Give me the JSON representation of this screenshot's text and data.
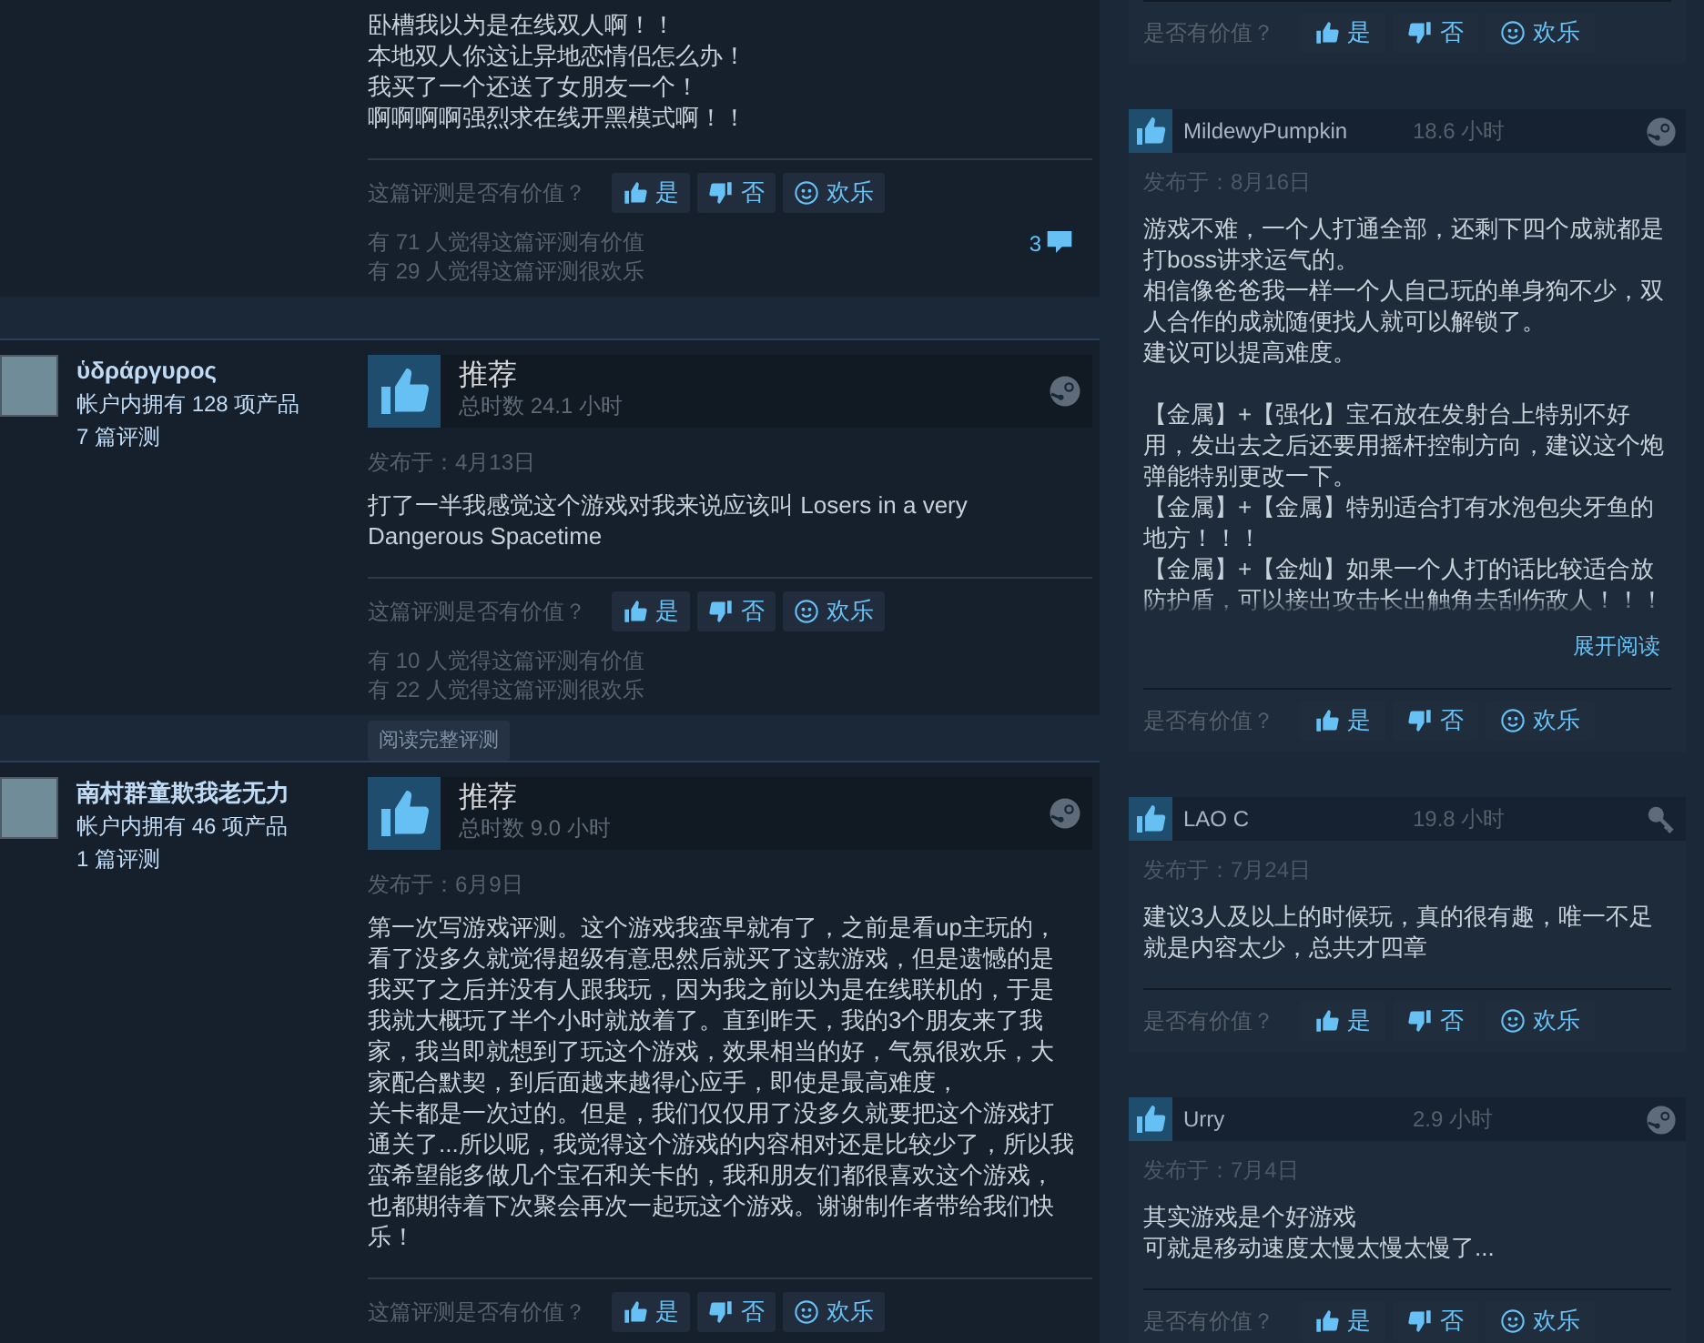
{
  "main_reviews": [
    {
      "blocks": [
        [
          "卧槽我以为是在线双人啊！！",
          "本地双人你这让异地恋情侣怎么办！",
          "我买了一个还送了女朋友一个！",
          "啊啊啊啊强烈求在线开黑模式啊！！"
        ]
      ],
      "helpful_prompt": "这篇评测是否有价值？",
      "buttons": [
        {
          "kind": "up",
          "label": "是"
        },
        {
          "kind": "down",
          "label": "否"
        },
        {
          "kind": "funny",
          "label": "欢乐"
        }
      ],
      "stats": [
        "有 71 人觉得这篇评测有价值",
        "有 29 人觉得这篇评测很欢乐"
      ],
      "comment_count": "3"
    },
    {
      "author": {
        "name": "ὑδράργυρος",
        "products": "帐户内拥有 128 项产品",
        "reviews": "7 篇评测"
      },
      "verdict": "推荐",
      "hours": "总时数 24.1 小时",
      "platform": {
        "kind": "steam"
      },
      "posted": "发布于：4月13日",
      "blocks": [
        [
          "打了一半我感觉这个游戏对我来说应该叫 Losers in a very Dangerous Spacetime"
        ]
      ],
      "helpful_prompt": "这篇评测是否有价值？",
      "buttons": [
        {
          "kind": "up",
          "label": "是"
        },
        {
          "kind": "down",
          "label": "否"
        },
        {
          "kind": "funny",
          "label": "欢乐"
        }
      ],
      "stats": [
        "有 10 人觉得这篇评测有价值",
        "有 22 人觉得这篇评测很欢乐"
      ],
      "read_more": "阅读完整评测"
    },
    {
      "author": {
        "name": "南村群童欺我老无力",
        "products": "帐户内拥有 46 项产品",
        "reviews": "1 篇评测"
      },
      "verdict": "推荐",
      "hours": "总时数 9.0 小时",
      "platform": {
        "kind": "steam"
      },
      "posted": "发布于：6月9日",
      "blocks": [
        [
          "第一次写游戏评测。这个游戏我蛮早就有了，之前是看up主玩的，看了没多久就觉得超级有意思然后就买了这款游戏，但是遗憾的是我买了之后并没有人跟我玩，因为我之前以为是在线联机的，于是我就大概玩了半个小时就放着了。直到昨天，我的3个朋友来了我家，我当即就想到了玩这个游戏，效果相当的好，气氛很欢乐，大家配合默契，到后面越来越得心应手，即使是最高难度，",
          "关卡都是一次过的。但是，我们仅仅用了没多久就要把这个游戏打通关了...所以呢，我觉得这个游戏的内容相对还是比较少了，所以我蛮希望能多做几个宝石和关卡的，我和朋友们都很喜欢这个游戏，也都期待着下次聚会再次一起玩这个游戏。谢谢制作者带给我们快乐！"
        ]
      ],
      "helpful_prompt": "这篇评测是否有价值？",
      "buttons": [
        {
          "kind": "up",
          "label": "是"
        },
        {
          "kind": "down",
          "label": "否"
        },
        {
          "kind": "funny",
          "label": "欢乐"
        }
      ]
    }
  ],
  "side_reviews": [
    {
      "helpful_prompt": "是否有价值？",
      "buttons": [
        {
          "kind": "up",
          "label": "是"
        },
        {
          "kind": "down",
          "label": "否"
        },
        {
          "kind": "funny",
          "label": "欢乐"
        }
      ]
    },
    {
      "author": "MildewyPumpkin",
      "hours": "18.6 小时",
      "platform": {
        "kind": "steam"
      },
      "posted": "发布于：8月16日",
      "blocks": [
        [
          "游戏不难，一个人打通全部，还剩下四个成就都是打boss讲求运气的。",
          "相信像爸爸我一样一个人自己玩的单身狗不少，双人合作的成就随便找人就可以解锁了。",
          "建议可以提高难度。"
        ],
        [
          "【金属】+【强化】宝石放在发射台上特别不好用，发出去之后还要用摇杆控制方向，建议这个炮弹能特别更改一下。",
          "【金属】+【金属】特别适合打有水泡包尖牙鱼的地方！！！",
          "【金属】+【金灿】如果一个人打的话比较适合放防护盾，可以接出攻击长出触角去刮伤敌人！！！"
        ]
      ],
      "expand": "展开阅读",
      "helpful_prompt": "是否有价值？",
      "buttons": [
        {
          "kind": "up",
          "label": "是"
        },
        {
          "kind": "down",
          "label": "否"
        },
        {
          "kind": "funny",
          "label": "欢乐"
        }
      ]
    },
    {
      "author": "LAO C",
      "hours": "19.8 小时",
      "platform": {
        "kind": "key"
      },
      "posted": "发布于：7月24日",
      "blocks": [
        [
          "建议3人及以上的时候玩，真的很有趣，唯一不足就是内容太少，总共才四章"
        ]
      ],
      "helpful_prompt": "是否有价值？",
      "buttons": [
        {
          "kind": "up",
          "label": "是"
        },
        {
          "kind": "down",
          "label": "否"
        },
        {
          "kind": "funny",
          "label": "欢乐"
        }
      ]
    },
    {
      "author": "Urry",
      "hours": "2.9 小时",
      "platform": {
        "kind": "steam"
      },
      "posted": "发布于：7月4日",
      "blocks": [
        [
          "其实游戏是个好游戏",
          "可就是移动速度太慢太慢太慢了..."
        ]
      ],
      "helpful_prompt": "是否有价值？",
      "buttons": [
        {
          "kind": "up",
          "label": "是"
        },
        {
          "kind": "down",
          "label": "否"
        },
        {
          "kind": "funny",
          "label": "欢乐"
        }
      ]
    }
  ]
}
